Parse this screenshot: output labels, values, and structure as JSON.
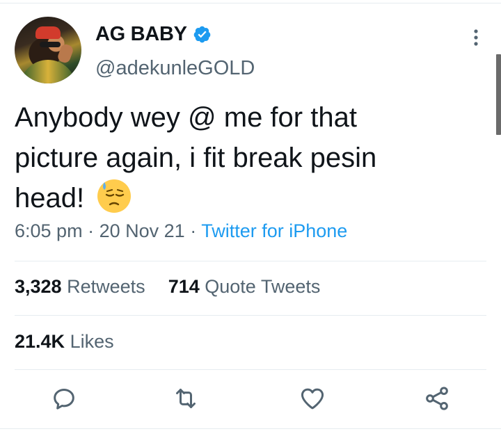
{
  "tweet": {
    "author": {
      "display_name": "AG BABY",
      "handle": "@adekunleGOLD",
      "verified": true
    },
    "text": "Anybody wey @ me for that picture again, i fit break pesin head!",
    "emoji": "downcast-face-with-sweat",
    "time": "6:05 pm",
    "date": "20 Nov 21",
    "separator": "·",
    "source": "Twitter for iPhone"
  },
  "stats": {
    "retweets": {
      "count": "3,328",
      "label": "Retweets"
    },
    "quote_tweets": {
      "count": "714",
      "label": "Quote Tweets"
    },
    "likes": {
      "count": "21.4K",
      "label": "Likes"
    }
  },
  "actions": [
    "reply-icon",
    "retweet-icon",
    "like-icon",
    "share-icon"
  ],
  "colors": {
    "text_primary": "#0f1419",
    "text_secondary": "#536471",
    "accent": "#1d9bf0",
    "divider": "#e6ecf0"
  }
}
